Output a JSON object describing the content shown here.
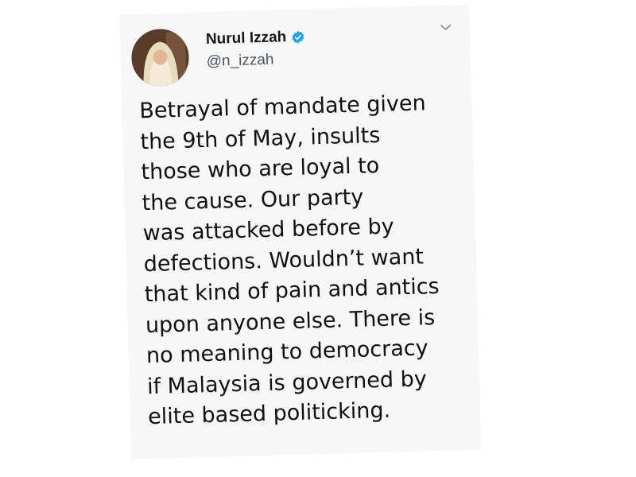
{
  "tweet": {
    "author": {
      "display_name": "Nurul Izzah",
      "handle": "@n_izzah",
      "verified": true
    },
    "lines": [
      "Betrayal of mandate given",
      "the 9th of May, insults",
      "those who are loyal to",
      "the cause. Our party",
      "was attacked before by",
      "defections. Wouldn’t want",
      "that kind of pain and antics",
      "upon anyone else. There is",
      "no meaning to democracy",
      "if Malaysia is governed by",
      "elite based politicking."
    ]
  },
  "icons": {
    "verified": "verified-badge-icon",
    "menu": "chevron-down-icon"
  },
  "colors": {
    "verified_blue": "#1da1f2",
    "text": "#111111",
    "handle": "#4d5359",
    "card_background": "#f7f7f7"
  }
}
